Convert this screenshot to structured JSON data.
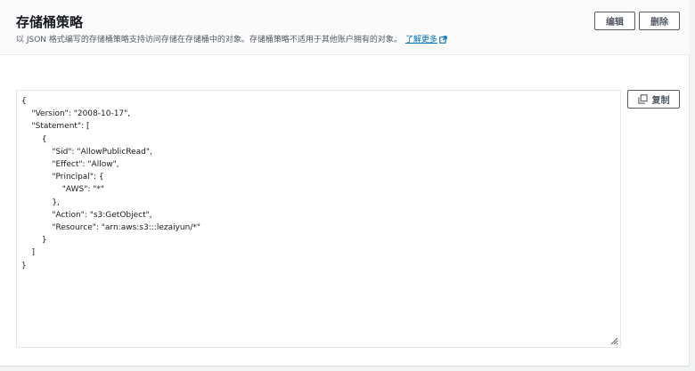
{
  "header": {
    "title": "存储桶策略",
    "description": "以 JSON 格式编写的存储桶策略支持访问存储在存储桶中的对象。存储桶策略不适用于其他账户拥有的对象。",
    "learn_more": "了解更多",
    "edit_label": "编辑",
    "delete_label": "删除"
  },
  "editor": {
    "copy_label": "复制",
    "policy_text": "{\n    \"Version\": \"2008-10-17\",\n    \"Statement\": [\n        {\n            \"Sid\": \"AllowPublicRead\",\n            \"Effect\": \"Allow\",\n            \"Principal\": {\n                \"AWS\": \"*\"\n            },\n            \"Action\": \"s3:GetObject\",\n            \"Resource\": \"arn:aws:s3:::lezaiyun/*\"\n        }\n    ]\n}"
  },
  "icons": {
    "external_link": "external-link-icon",
    "copy": "copy-icon",
    "resize": "resize-grip-icon"
  },
  "colors": {
    "link": "#0073bb",
    "button_border": "#545b64",
    "header_bg": "#fafafa"
  }
}
